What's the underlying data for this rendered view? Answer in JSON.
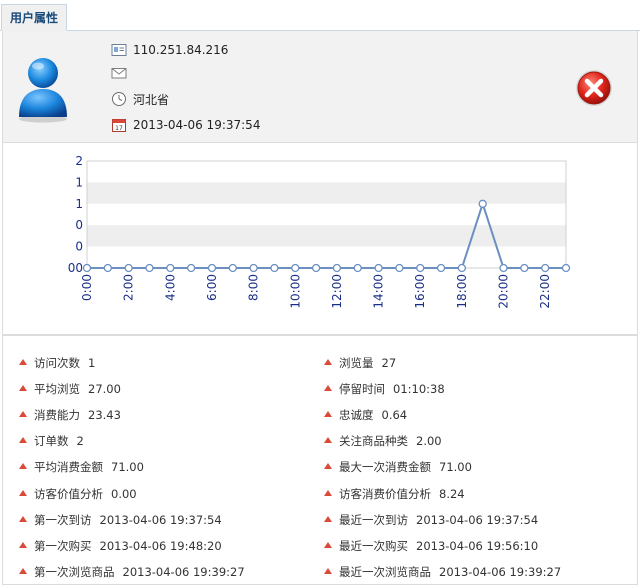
{
  "tab": {
    "label": "用户属性"
  },
  "profile": {
    "ip": "110.251.84.216",
    "email": "",
    "region": "河北省",
    "datetime": "2013-04-06 19:37:54"
  },
  "colors": {
    "accent": "#1a4a7a",
    "bullet": "#d94a38",
    "line": "#6a8fc0"
  },
  "chart_data": {
    "type": "line",
    "categories": [
      "0:00",
      "1:00",
      "2:00",
      "3:00",
      "4:00",
      "5:00",
      "6:00",
      "7:00",
      "8:00",
      "9:00",
      "10:00",
      "11:00",
      "12:00",
      "13:00",
      "14:00",
      "15:00",
      "16:00",
      "17:00",
      "18:00",
      "19:00",
      "20:00",
      "21:00",
      "22:00",
      "23:00"
    ],
    "x_tick_labels": [
      "0:00",
      "2:00",
      "4:00",
      "6:00",
      "8:00",
      "10:00",
      "12:00",
      "14:00",
      "16:00",
      "18:00",
      "20:00",
      "22:00"
    ],
    "y_tick_labels": [
      "2",
      "1",
      "1",
      "0",
      "0",
      "00"
    ],
    "values": [
      0,
      0,
      0,
      0,
      0,
      0,
      0,
      0,
      0,
      0,
      0,
      0,
      0,
      0,
      0,
      0,
      0,
      0,
      0,
      1.5,
      0,
      0,
      0,
      0
    ],
    "ylim": [
      0,
      2.5
    ],
    "grid": true,
    "title": "",
    "xlabel": "",
    "ylabel": ""
  },
  "stats": {
    "left": [
      {
        "label": "访问次数",
        "value": "1"
      },
      {
        "label": "平均浏览",
        "value": "27.00"
      },
      {
        "label": "消费能力",
        "value": "23.43"
      },
      {
        "label": "订单数",
        "value": "2"
      },
      {
        "label": "平均消费金额",
        "value": "71.00"
      },
      {
        "label": "访客价值分析",
        "value": "0.00"
      },
      {
        "label": "第一次到访",
        "value": "2013-04-06 19:37:54"
      },
      {
        "label": "第一次购买",
        "value": "2013-04-06 19:48:20"
      },
      {
        "label": "第一次浏览商品",
        "value": "2013-04-06 19:39:27"
      }
    ],
    "right": [
      {
        "label": "浏览量",
        "value": "27"
      },
      {
        "label": "停留时间",
        "value": "01:10:38"
      },
      {
        "label": "忠诚度",
        "value": "0.64"
      },
      {
        "label": "关注商品种类",
        "value": "2.00"
      },
      {
        "label": "最大一次消费金额",
        "value": "71.00"
      },
      {
        "label": "访客消费价值分析",
        "value": "8.24"
      },
      {
        "label": "最近一次到访",
        "value": "2013-04-06 19:37:54"
      },
      {
        "label": "最近一次购买",
        "value": "2013-04-06 19:56:10"
      },
      {
        "label": "最近一次浏览商品",
        "value": "2013-04-06 19:39:27"
      }
    ]
  }
}
